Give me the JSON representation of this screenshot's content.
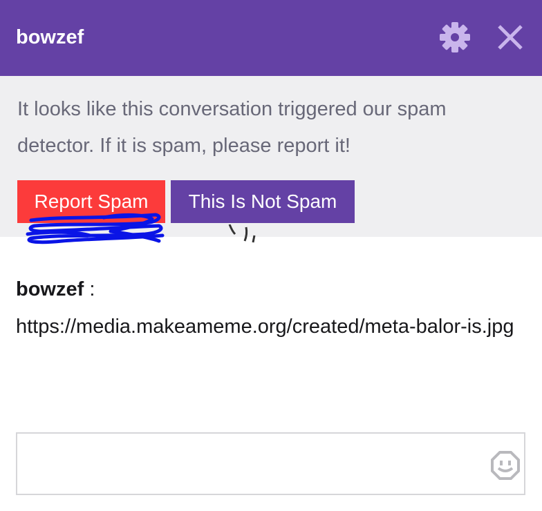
{
  "header": {
    "title": "bowzef",
    "settings_icon": "gear-icon",
    "close_icon": "close-icon",
    "background_color": "#6441a5"
  },
  "spam_notice": {
    "message": "It looks like this conversation triggered our spam detector. If it is spam, please report it!",
    "report_label": "Report Spam",
    "not_spam_label": "This Is Not Spam",
    "report_color": "#fc3b3b",
    "not_spam_color": "#6441a5"
  },
  "conversation": {
    "messages": [
      {
        "author": "bowzef",
        "separator": " :",
        "text": "https://media.makeameme.org/created/meta-balor-is.jpg"
      }
    ]
  },
  "composer": {
    "value": "",
    "placeholder": "",
    "emote_icon": "emote-smiley-icon"
  }
}
